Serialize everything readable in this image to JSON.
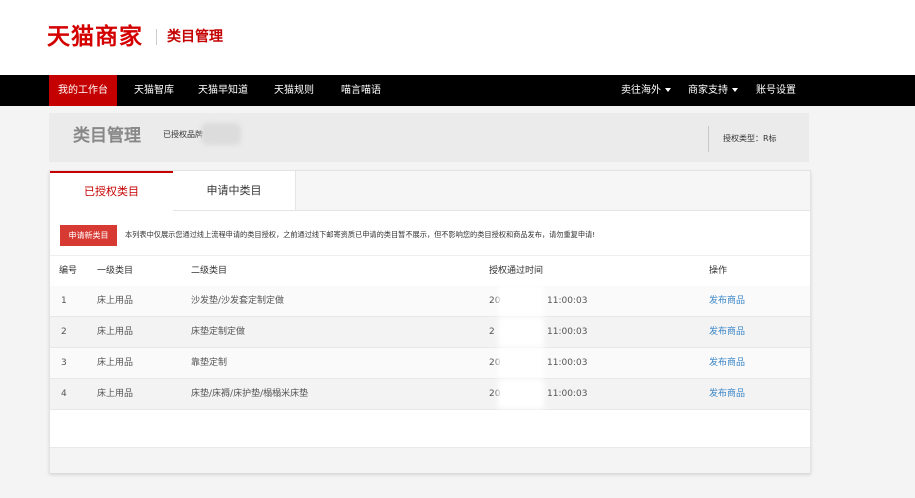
{
  "logo": {
    "brand": "天猫商家",
    "section": "类目管理"
  },
  "nav": {
    "items": [
      {
        "label": "我的工作台",
        "active": true
      },
      {
        "label": "天猫智库"
      },
      {
        "label": "天猫早知道"
      },
      {
        "label": "天猫规则"
      },
      {
        "label": "喵言喵语"
      }
    ],
    "right": [
      {
        "label": "卖往海外",
        "dropdown": true
      },
      {
        "label": "商家支持",
        "dropdown": true
      },
      {
        "label": "账号设置"
      }
    ]
  },
  "header": {
    "title": "类目管理",
    "authorized_brand_label": "已授权品牌",
    "auth_type": "授权类型：R标"
  },
  "tabs": [
    {
      "label": "已授权类目",
      "active": true
    },
    {
      "label": "申请中类目",
      "active": false
    }
  ],
  "apply_button": "申请新类目",
  "notice": "本列表中仅展示您通过线上流程申请的类目授权，之前通过线下邮寄资质已申请的类目暂不展示，但不影响您的类目授权和商品发布，请勿重复申请!",
  "table": {
    "headers": [
      "编号",
      "一级类目",
      "二级类目",
      "授权通过时间",
      "操作"
    ],
    "rows": [
      {
        "no": "1",
        "level1": "床上用品",
        "level2": "沙发垫/沙发套定制定做",
        "time_prefix": "20",
        "time_suffix": "11:00:03",
        "action": "发布商品"
      },
      {
        "no": "2",
        "level1": "床上用品",
        "level2": "床垫定制定做",
        "time_prefix": "2",
        "time_suffix": "11:00:03",
        "action": "发布商品"
      },
      {
        "no": "3",
        "level1": "床上用品",
        "level2": "靠垫定制",
        "time_prefix": "20",
        "time_suffix": "11:00:03",
        "action": "发布商品"
      },
      {
        "no": "4",
        "level1": "床上用品",
        "level2": "床垫/床褥/床护垫/榻榻米床垫",
        "time_prefix": "20",
        "time_suffix": "11:00:03",
        "action": "发布商品"
      }
    ]
  },
  "colors": {
    "brand_red": "#c40000",
    "button_red": "#d73a33",
    "link_blue": "#3a86c8",
    "nav_bg": "#000000"
  }
}
